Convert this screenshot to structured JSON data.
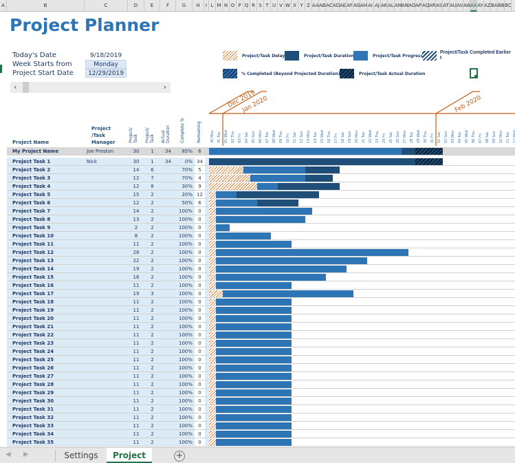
{
  "column_letters": [
    "A",
    "B",
    "C",
    "D",
    "E",
    "F",
    "G",
    "H",
    "I",
    "L",
    "M",
    "N",
    "O",
    "P",
    "Q",
    "R",
    "S",
    "T",
    "U",
    "V",
    "W",
    "X",
    "Y",
    "Z",
    "AA",
    "AB",
    "AC",
    "AD",
    "AE",
    "AF",
    "AG",
    "AH",
    "AI",
    "AJ",
    "AK",
    "AL",
    "AM",
    "AN",
    "AO",
    "AP",
    "AQ",
    "AR",
    "AS",
    "AT",
    "AU",
    "AV",
    "AW",
    "AX",
    "AY",
    "AZ",
    "BA",
    "BB",
    "BC"
  ],
  "selected_column": "AX",
  "title": "Project Planner",
  "info": {
    "today_label": "Today's Date",
    "today_value": "9/18/2019",
    "week_label": "Week Starts from",
    "week_value": "Monday",
    "start_label": "Project Start Date",
    "start_value": "12/29/2019"
  },
  "scrollbar": {
    "left": "‹",
    "right": "›"
  },
  "legend": {
    "delay": "Project/Task Delay",
    "duration": "Project/Task Duration",
    "progress": "Project/Task Progress",
    "early": "Project/Task Completed Earlier t",
    "beyond": "% Completed (Beyond Projected Duration)",
    "actual": "Project/Task Actual Duration"
  },
  "colors": {
    "delay": "#e07b2c",
    "duration": "#1f4e79",
    "progress": "#2e75b6",
    "accent": "#c55a11"
  },
  "months": [
    "Dec 2019",
    "Jan 2020",
    "Feb 2020"
  ],
  "headers": {
    "name": "Project Name",
    "manager": "Project /Task Manager",
    "duration": "Project/ Task",
    "start": "Project/ Task",
    "actual": "Actual Duration",
    "complete": "Complete %",
    "remaining": "Remaining"
  },
  "days": [
    "30 Mon",
    "31 Tue",
    "01 Wed",
    "02 Thu",
    "03 Fri",
    "04 Sat",
    "05 Sun",
    "06 Mon",
    "07 Tue",
    "08 Wed",
    "09 Thu",
    "10 Fri",
    "11 Sat",
    "12 Sun",
    "13 Mon",
    "14 Tue",
    "15 Wed",
    "16 Thu",
    "17 Fri",
    "18 Sat",
    "19 Sun",
    "20 Mon",
    "21 Tue",
    "22 Wed",
    "23 Thu",
    "24 Fri",
    "25 Sat",
    "26 Sun",
    "27 Mon",
    "28 Tue",
    "29 Wed",
    "30 Thu",
    "31 Fri",
    "01 Sat",
    "02 Sun",
    "03 Mon",
    "04 Tue",
    "05 Wed",
    "06 Thu",
    "07 Fri",
    "08 Sat",
    "09 Sun",
    "10 Mon",
    "11 Tue",
    "12 Wed"
  ],
  "summary": {
    "name": "My Project Name",
    "manager": "Joe Preston",
    "duration": "30",
    "start": "1",
    "actual": "34",
    "complete": "85%",
    "remaining": "6"
  },
  "tasks": [
    {
      "name": "Project Task 1",
      "manager": "Nick",
      "duration": "30",
      "start": "1",
      "actual": "34",
      "complete": "0%",
      "remaining": "34"
    },
    {
      "name": "Project Task 2",
      "manager": "",
      "duration": "14",
      "start": "6",
      "actual": "",
      "complete": "70%",
      "remaining": "5"
    },
    {
      "name": "Project Task 3",
      "manager": "",
      "duration": "12",
      "start": "7",
      "actual": "",
      "complete": "70%",
      "remaining": "4"
    },
    {
      "name": "Project Task 4",
      "manager": "",
      "duration": "12",
      "start": "8",
      "actual": "",
      "complete": "30%",
      "remaining": "9"
    },
    {
      "name": "Project Task 5",
      "manager": "",
      "duration": "15",
      "start": "2",
      "actual": "",
      "complete": "20%",
      "remaining": "12"
    },
    {
      "name": "Project Task 6",
      "manager": "",
      "duration": "12",
      "start": "2",
      "actual": "",
      "complete": "50%",
      "remaining": "6"
    },
    {
      "name": "Project Task 7",
      "manager": "",
      "duration": "14",
      "start": "2",
      "actual": "",
      "complete": "100%",
      "remaining": "0"
    },
    {
      "name": "Project Task 8",
      "manager": "",
      "duration": "13",
      "start": "2",
      "actual": "",
      "complete": "100%",
      "remaining": "0"
    },
    {
      "name": "Project Task 9",
      "manager": "",
      "duration": "2",
      "start": "2",
      "actual": "",
      "complete": "100%",
      "remaining": "0"
    },
    {
      "name": "Project Task 10",
      "manager": "",
      "duration": "8",
      "start": "2",
      "actual": "",
      "complete": "100%",
      "remaining": "0"
    },
    {
      "name": "Project Task 11",
      "manager": "",
      "duration": "11",
      "start": "2",
      "actual": "",
      "complete": "100%",
      "remaining": "0"
    },
    {
      "name": "Project Task 12",
      "manager": "",
      "duration": "28",
      "start": "2",
      "actual": "",
      "complete": "100%",
      "remaining": "0"
    },
    {
      "name": "Project Task 13",
      "manager": "",
      "duration": "22",
      "start": "2",
      "actual": "",
      "complete": "100%",
      "remaining": "0"
    },
    {
      "name": "Project Task 14",
      "manager": "",
      "duration": "19",
      "start": "2",
      "actual": "",
      "complete": "100%",
      "remaining": "0"
    },
    {
      "name": "Project Task 15",
      "manager": "",
      "duration": "16",
      "start": "2",
      "actual": "",
      "complete": "100%",
      "remaining": "0"
    },
    {
      "name": "Project Task 16",
      "manager": "",
      "duration": "11",
      "start": "2",
      "actual": "",
      "complete": "100%",
      "remaining": "0"
    },
    {
      "name": "Project Task 17",
      "manager": "",
      "duration": "19",
      "start": "3",
      "actual": "",
      "complete": "100%",
      "remaining": "0"
    },
    {
      "name": "Project Task 18",
      "manager": "",
      "duration": "11",
      "start": "2",
      "actual": "",
      "complete": "100%",
      "remaining": "0"
    },
    {
      "name": "Project Task 19",
      "manager": "",
      "duration": "11",
      "start": "2",
      "actual": "",
      "complete": "100%",
      "remaining": "0"
    },
    {
      "name": "Project Task 20",
      "manager": "",
      "duration": "11",
      "start": "2",
      "actual": "",
      "complete": "100%",
      "remaining": "0"
    },
    {
      "name": "Project Task 21",
      "manager": "",
      "duration": "11",
      "start": "2",
      "actual": "",
      "complete": "100%",
      "remaining": "0"
    },
    {
      "name": "Project Task 22",
      "manager": "",
      "duration": "11",
      "start": "2",
      "actual": "",
      "complete": "100%",
      "remaining": "0"
    },
    {
      "name": "Project Task 23",
      "manager": "",
      "duration": "11",
      "start": "2",
      "actual": "",
      "complete": "100%",
      "remaining": "0"
    },
    {
      "name": "Project Task 24",
      "manager": "",
      "duration": "11",
      "start": "2",
      "actual": "",
      "complete": "100%",
      "remaining": "0"
    },
    {
      "name": "Project Task 25",
      "manager": "",
      "duration": "11",
      "start": "2",
      "actual": "",
      "complete": "100%",
      "remaining": "0"
    },
    {
      "name": "Project Task 26",
      "manager": "",
      "duration": "11",
      "start": "2",
      "actual": "",
      "complete": "100%",
      "remaining": "0"
    },
    {
      "name": "Project Task 27",
      "manager": "",
      "duration": "11",
      "start": "2",
      "actual": "",
      "complete": "100%",
      "remaining": "0"
    },
    {
      "name": "Project Task 28",
      "manager": "",
      "duration": "11",
      "start": "2",
      "actual": "",
      "complete": "100%",
      "remaining": "0"
    },
    {
      "name": "Project Task 29",
      "manager": "",
      "duration": "11",
      "start": "2",
      "actual": "",
      "complete": "100%",
      "remaining": "0"
    },
    {
      "name": "Project Task 30",
      "manager": "",
      "duration": "11",
      "start": "2",
      "actual": "",
      "complete": "100%",
      "remaining": "0"
    },
    {
      "name": "Project Task 31",
      "manager": "",
      "duration": "11",
      "start": "2",
      "actual": "",
      "complete": "100%",
      "remaining": "0"
    },
    {
      "name": "Project Task 32",
      "manager": "",
      "duration": "11",
      "start": "2",
      "actual": "",
      "complete": "100%",
      "remaining": "0"
    },
    {
      "name": "Project Task 33",
      "manager": "",
      "duration": "11",
      "start": "2",
      "actual": "",
      "complete": "100%",
      "remaining": "0"
    },
    {
      "name": "Project Task 34",
      "manager": "",
      "duration": "11",
      "start": "2",
      "actual": "",
      "complete": "100%",
      "remaining": "0"
    },
    {
      "name": "Project Task 35",
      "manager": "",
      "duration": "11",
      "start": "2",
      "actual": "",
      "complete": "100%",
      "remaining": "0"
    }
  ],
  "sheet_tabs": [
    {
      "label": "Settings",
      "active": false
    },
    {
      "label": "Project",
      "active": true
    }
  ],
  "add_sheet": "+"
}
